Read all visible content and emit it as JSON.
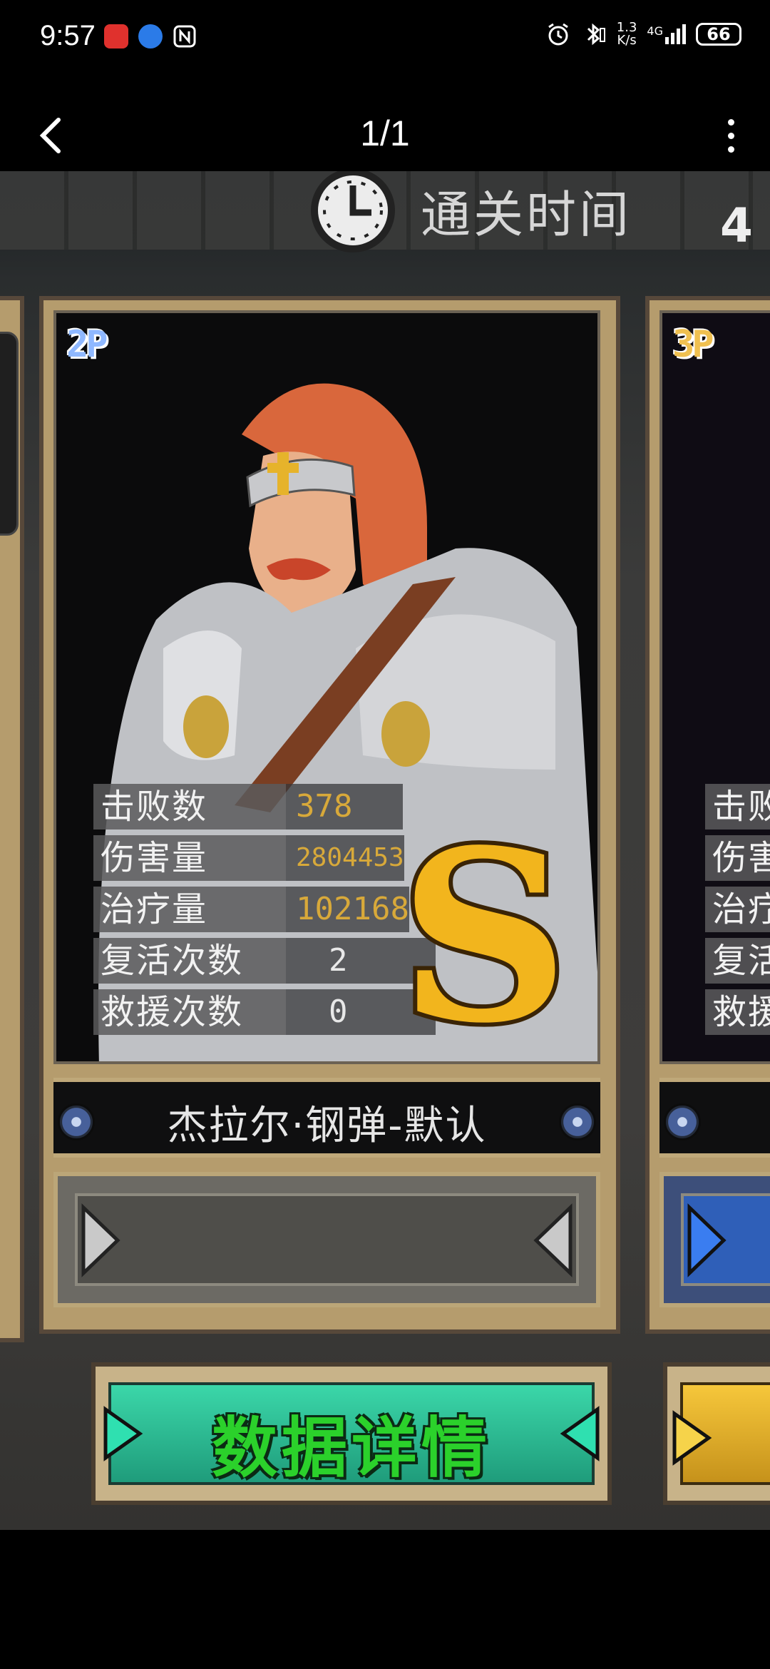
{
  "status_bar": {
    "time": "9:57",
    "network_speed": "1.3",
    "network_unit": "K/s",
    "signal": "4G",
    "battery": "66"
  },
  "viewer": {
    "page_counter": "1/1"
  },
  "game": {
    "clear_time_label": "通关时间",
    "clear_time_value": "4",
    "player_card": {
      "badge": "2P",
      "stats": [
        {
          "label": "击败数",
          "value": "378"
        },
        {
          "label": "伤害量",
          "value": "2804453"
        },
        {
          "label": "治疗量",
          "value": "102168"
        },
        {
          "label": "复活次数",
          "value": "2"
        },
        {
          "label": "救援次数",
          "value": "0"
        }
      ],
      "grade": "S",
      "name": "杰拉尔·钢弹-默认"
    },
    "next_card": {
      "badge": "3P",
      "stats": [
        {
          "label": "击败"
        },
        {
          "label": "伤害"
        },
        {
          "label": "治疗"
        },
        {
          "label": "复活"
        },
        {
          "label": "救援"
        }
      ]
    },
    "detail_button_label": "数据详情"
  }
}
